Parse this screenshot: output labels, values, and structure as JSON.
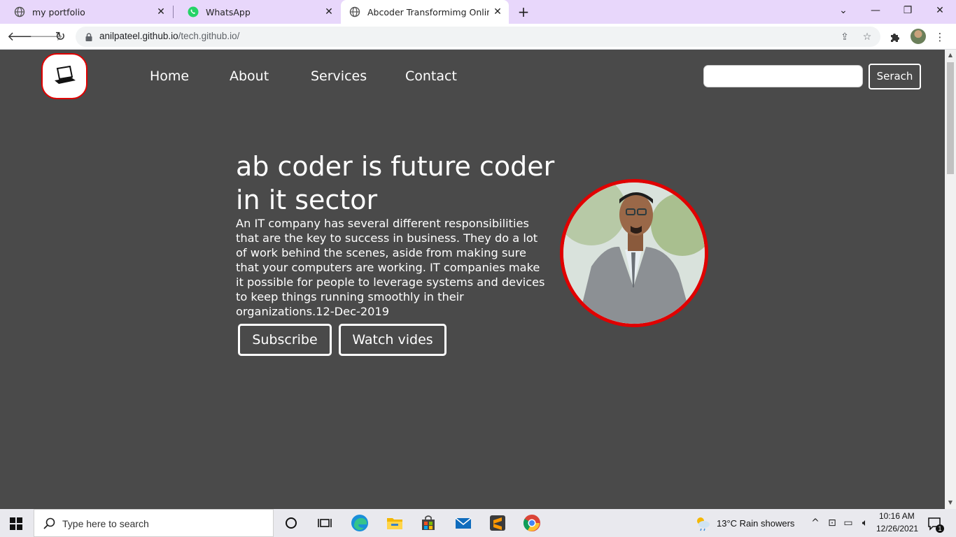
{
  "browser": {
    "tabs": [
      {
        "label": "my portfolio",
        "close": "✕"
      },
      {
        "label": "WhatsApp",
        "close": "✕"
      },
      {
        "label": "Abcoder Transformimg Online Ed",
        "close": "✕"
      }
    ],
    "new_tab": "+",
    "window_controls": {
      "tablist": "⌄",
      "minimize": "—",
      "restore": "❐",
      "close": "✕"
    },
    "url_host": "anilpateel.github.io",
    "url_path": "/tech.github.io/"
  },
  "site": {
    "nav": [
      "Home",
      "About",
      "Services",
      "Contact"
    ],
    "search_placeholder": "",
    "search_button": "Serach",
    "hero": {
      "title": "ab coder is future coder in it sector",
      "text": "An IT company has several different responsibilities that are the key to success in business. They do a lot of work behind the scenes, aside from making sure that your computers are working. IT companies make it possible for people to leverage systems and devices to keep things running smoothly in their organizations.12-Dec-2019",
      "buttons": [
        "Subscribe",
        "Watch vides"
      ]
    },
    "accent_color": "#e00000"
  },
  "taskbar": {
    "search_text": "Type here to search",
    "weather": "13°C  Rain showers",
    "time": "10:16 AM",
    "date": "12/26/2021",
    "notification_count": "1"
  }
}
